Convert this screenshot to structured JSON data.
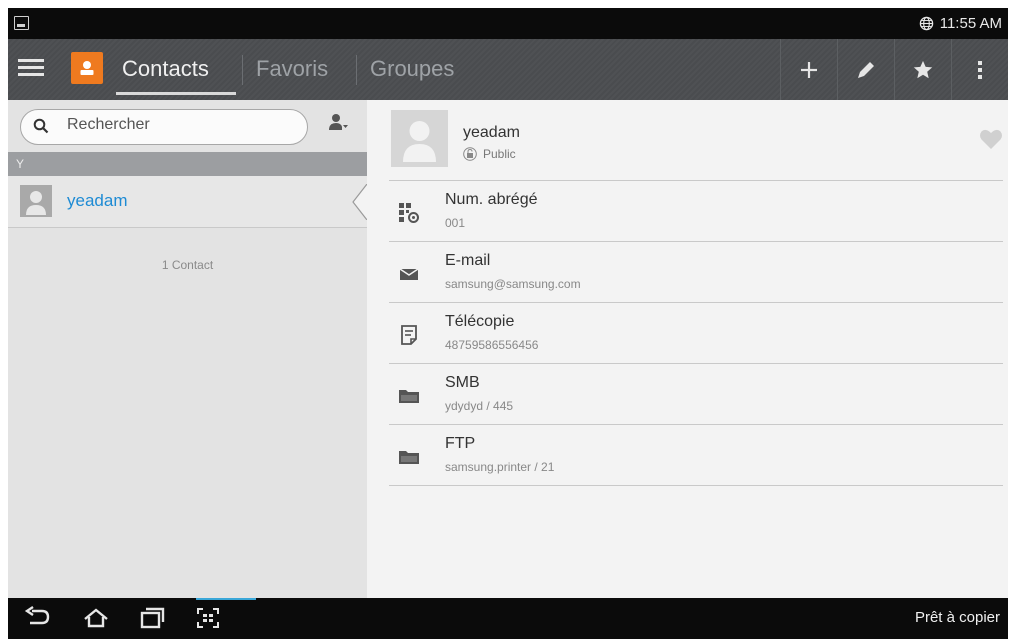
{
  "status_bar": {
    "time": "11:55 AM",
    "left_icon": "image-notification-icon",
    "right_icon": "globe-icon"
  },
  "action_bar": {
    "menu_icon": "hamburger-icon",
    "app_icon": "contacts-app-icon",
    "tabs": [
      {
        "label": "Contacts",
        "active": true
      },
      {
        "label": "Favoris",
        "active": false
      },
      {
        "label": "Groupes",
        "active": false
      }
    ],
    "actions": [
      "plus-icon",
      "pencil-icon",
      "star-icon",
      "overflow-icon"
    ]
  },
  "left_pane": {
    "search_placeholder": "Rechercher",
    "section_letter": "Y",
    "contacts": [
      {
        "name": "yeadam"
      }
    ],
    "count_text": "1 Contact"
  },
  "detail": {
    "name": "yeadam",
    "privacy": "Public",
    "fields": [
      {
        "icon": "speed-dial-icon",
        "label": "Num. abrégé",
        "value": "001"
      },
      {
        "icon": "email-icon",
        "label": "E-mail",
        "value": "samsung@samsung.com"
      },
      {
        "icon": "fax-icon",
        "label": "Télécopie",
        "value": "48759586556456"
      },
      {
        "icon": "smb-folder-icon",
        "label": "SMB",
        "value": "ydydyd / 445"
      },
      {
        "icon": "ftp-folder-icon",
        "label": "FTP",
        "value": "samsung.printer / 21"
      }
    ]
  },
  "nav_bar": {
    "buttons": [
      "back-icon",
      "home-icon",
      "recent-apps-icon",
      "screen-capture-icon"
    ],
    "status_text": "Prêt à copier"
  },
  "colors": {
    "accent_blue": "#1e8bd4",
    "app_icon_orange": "#ef7a1f",
    "action_bar": "#4f5154",
    "nav_highlight": "#3aa7d8"
  }
}
